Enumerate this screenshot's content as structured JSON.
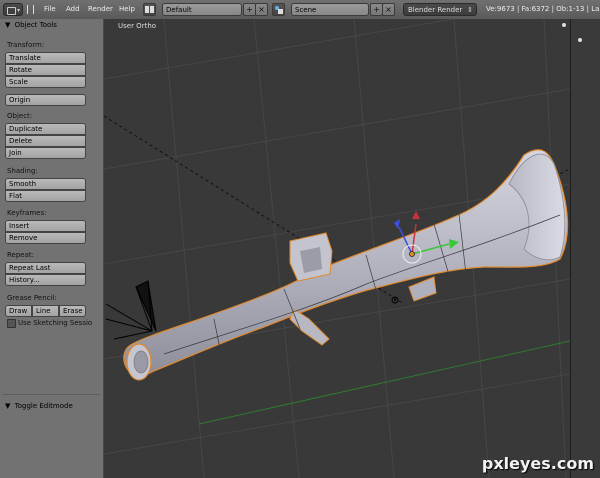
{
  "header": {
    "menu": [
      {
        "label": "File"
      },
      {
        "label": "Add"
      },
      {
        "label": "Render"
      },
      {
        "label": "Help"
      }
    ],
    "screen_layout": "Default",
    "scene": "Scene",
    "render_engine": "Blender Render",
    "stats": "Ve:9673 | Fa:6372 | Ob:1-13 | La"
  },
  "toolshelf": {
    "title": "Object Tools",
    "transform": {
      "label": "Transform:",
      "buttons": [
        "Translate",
        "Rotate",
        "Scale"
      ]
    },
    "origin": {
      "button": "Origin"
    },
    "object": {
      "label": "Object:",
      "buttons": [
        "Duplicate",
        "Delete",
        "Join"
      ]
    },
    "shading": {
      "label": "Shading:",
      "buttons": [
        "Smooth",
        "Flat"
      ]
    },
    "keyframes": {
      "label": "Keyframes:",
      "buttons": [
        "Insert",
        "Remove"
      ]
    },
    "repeat": {
      "label": "Repeat:",
      "buttons": [
        "Repeat Last",
        "History..."
      ]
    },
    "grease_pencil": {
      "label": "Grease Pencil:",
      "buttons": [
        "Draw",
        "Line",
        "Erase"
      ],
      "checkbox": "Use Sketching Sessio"
    },
    "toggle_editmode": "Toggle Editmode"
  },
  "viewport": {
    "view_label": "User Ortho"
  },
  "watermark": "pxleyes.com",
  "colors": {
    "header_bg": "#646464",
    "toolshelf_bg": "#727272",
    "viewport_bg": "#393939",
    "selection_outline": "#e08a2e",
    "mesh_fill": "#b9b9c4",
    "axis_x": "#c8323c",
    "axis_y": "#3ac83a",
    "axis_z": "#3c50e6"
  },
  "icons": [
    "editor-type-icon",
    "screen-layout-icon",
    "scene-icon",
    "add-icon",
    "close-icon",
    "dropdown-arrow-icon",
    "panel-collapse-icon",
    "lamp-icon",
    "camera-icon",
    "manipulator-icon",
    "object-origin-icon"
  ]
}
